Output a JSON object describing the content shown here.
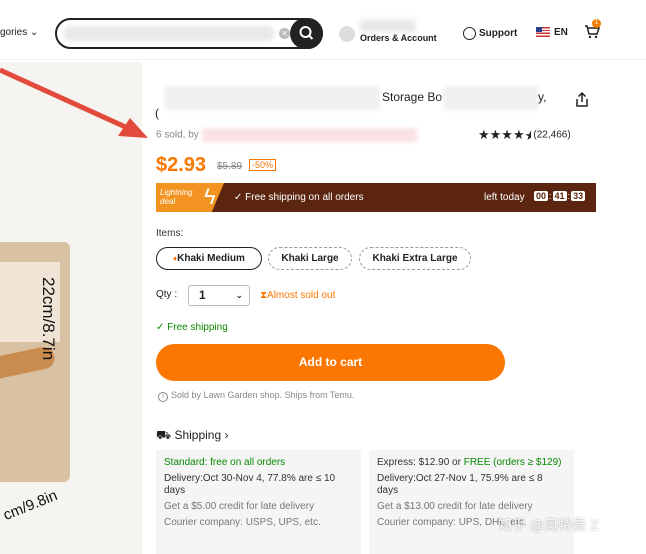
{
  "header": {
    "categories_label": "gories",
    "search": {
      "value": "",
      "placeholder": ""
    },
    "orders_label": "Orders & Account",
    "support_label": "Support",
    "language_label": "EN",
    "cart_count": "1"
  },
  "image": {
    "dimension_height": "22cm/8.7in",
    "dimension_width": "cm/9.8in"
  },
  "product": {
    "title_visible": "Storage Bo",
    "title_end": "y,",
    "title_line2_start": "(",
    "sold_prefix": "6 sold, by",
    "rating_count": "(22,466)",
    "rating_value": 4.5,
    "price": "$2.93",
    "old_price": "$5.89",
    "discount": "-50%"
  },
  "deal": {
    "badge": "Lightning deal",
    "free_shipping": "Free shipping on all orders",
    "left_today": "left today",
    "timer": [
      "00",
      "41",
      "33"
    ]
  },
  "options": {
    "label": "Items:",
    "items": [
      "Khaki Medium",
      "Khaki Large",
      "Khaki Extra Large"
    ],
    "selected": "Khaki Medium"
  },
  "quantity": {
    "label": "Qty :",
    "value": "1",
    "stock_note": "Almost sold out"
  },
  "free_shipping_note": "Free shipping",
  "add_to_cart": "Add to cart",
  "sold_by": "Sold by Lawn Garden shop. Ships from Temu.",
  "shipping": {
    "heading": "Shipping",
    "standard": {
      "title": "Standard: free on all orders",
      "delivery": "Delivery:Oct 30-Nov 4, 77.8% are ≤ 10 days",
      "credit": "Get a $5.00 credit for late delivery",
      "couriers": "Courier company:  USPS,  UPS, etc."
    },
    "express": {
      "title_prefix": "Express: $12.90 or ",
      "title_free": "FREE (orders ≥ $129)",
      "delivery": "Delivery:Oct 27-Nov 1, 75.9% are ≤ 8 days",
      "credit": "Get a $13.00 credit for late delivery",
      "couriers": "Courier company:  UPS,  DHL, etc."
    }
  },
  "watermark": "知乎 @奥特曼 Z",
  "colors": {
    "accent": "#fb7701",
    "deal_bg": "#5b2510",
    "green": "#0a8800",
    "arrow": "#e24a3b"
  }
}
